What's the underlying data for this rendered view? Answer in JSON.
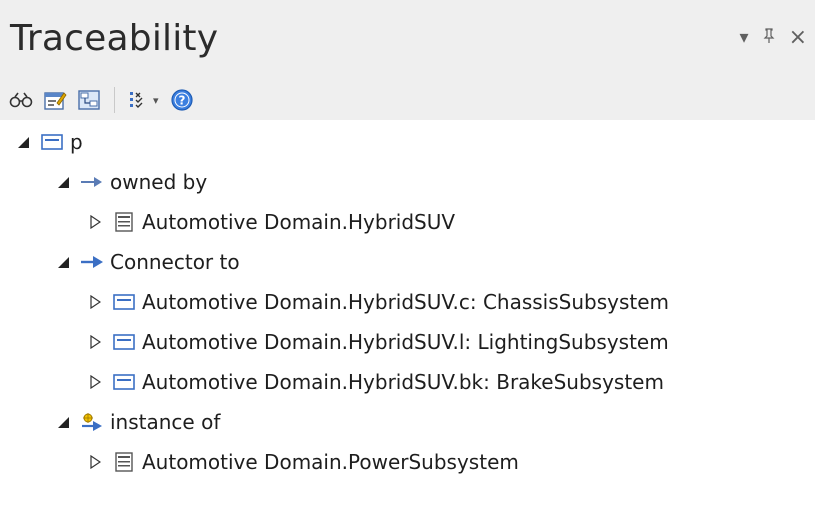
{
  "window": {
    "title": "Traceability",
    "controls": {
      "menu": "▾",
      "pin": "ᵖ",
      "close": "×"
    }
  },
  "toolbar": {
    "buttons": [
      {
        "icon": "binoculars-icon"
      },
      {
        "icon": "properties-icon"
      },
      {
        "icon": "diagram-icon"
      },
      {
        "icon": "filter-list-icon",
        "has_dropdown": true
      },
      {
        "icon": "help-icon"
      }
    ]
  },
  "tree": {
    "root": {
      "label": "p",
      "icon": "part-icon",
      "expanded": true
    },
    "groups": [
      {
        "label": "owned by",
        "icon": "owned-by-arrow-icon",
        "expanded": true,
        "items": [
          {
            "label": "Automotive Domain.HybridSUV",
            "icon": "block-icon"
          }
        ]
      },
      {
        "label": "Connector to",
        "icon": "connector-arrow-icon",
        "expanded": true,
        "items": [
          {
            "label": "Automotive Domain.HybridSUV.c: ChassisSubsystem",
            "icon": "part-icon"
          },
          {
            "label": "Automotive Domain.HybridSUV.l: LightingSubsystem",
            "icon": "part-icon"
          },
          {
            "label": "Automotive Domain.HybridSUV.bk: BrakeSubsystem",
            "icon": "part-icon"
          }
        ]
      },
      {
        "label": "instance of",
        "icon": "instance-of-icon",
        "expanded": true,
        "items": [
          {
            "label": "Automotive Domain.PowerSubsystem",
            "icon": "block-icon"
          }
        ]
      }
    ]
  },
  "colors": {
    "header_bg": "#efefef",
    "tree_bg": "#ffffff",
    "arrow_blue": "#5a7bb5",
    "icon_blue": "#3b6fc4"
  }
}
